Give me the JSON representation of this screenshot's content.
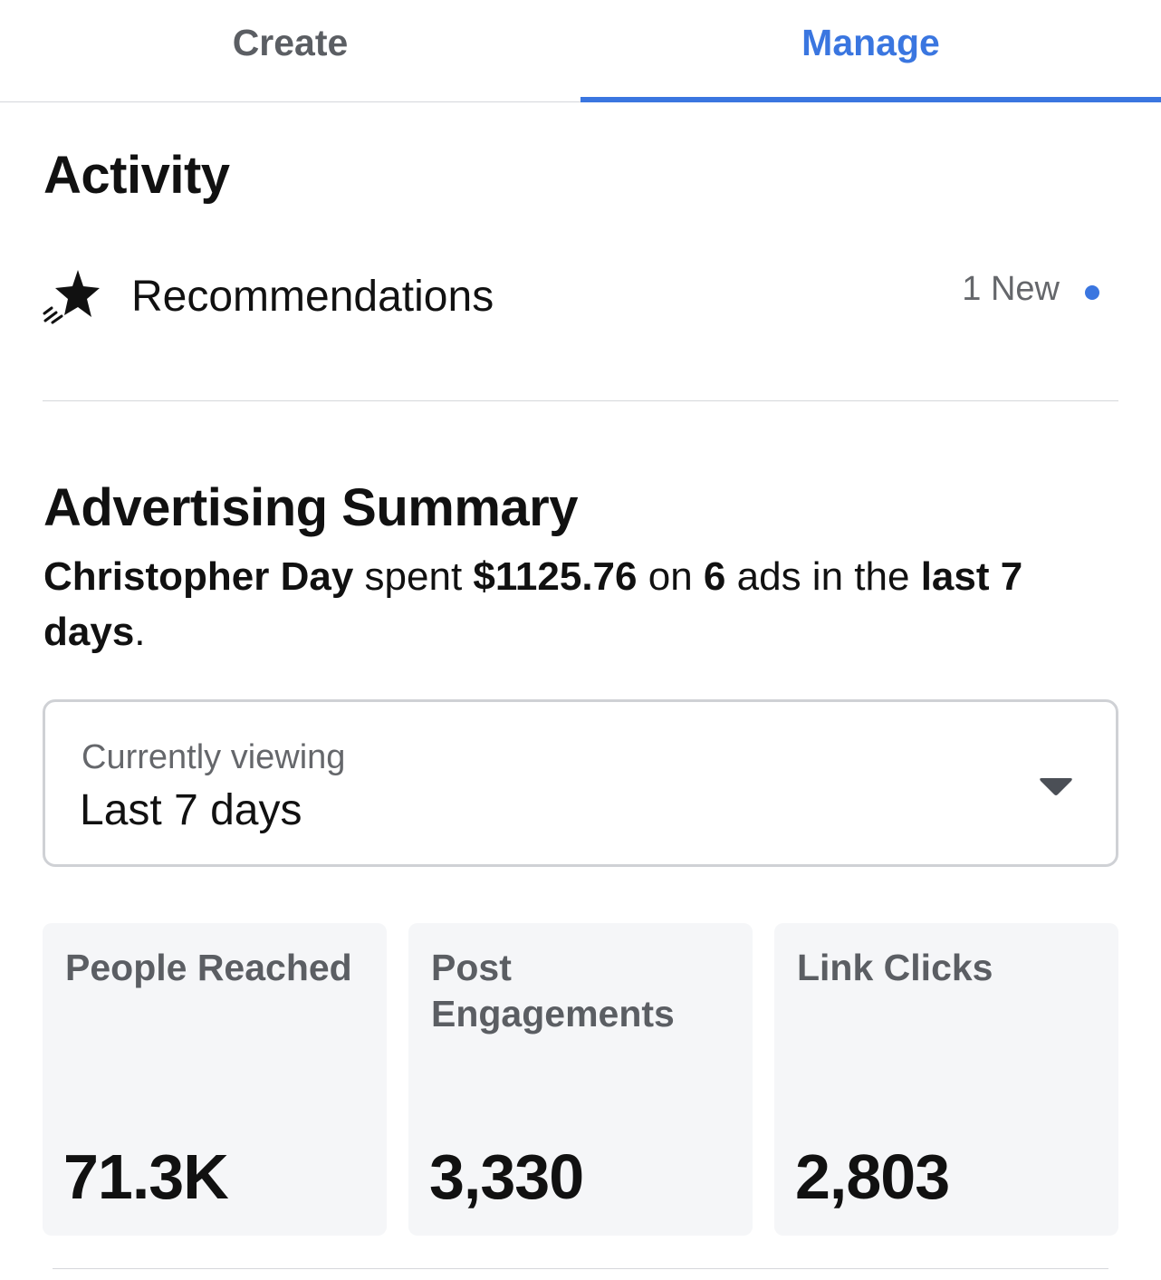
{
  "tabs": [
    {
      "label": "Create",
      "active": false
    },
    {
      "label": "Manage",
      "active": true
    }
  ],
  "activity": {
    "title": "Activity",
    "recommendations": {
      "label": "Recommendations",
      "badge": "1 New",
      "icon": "shooting-star-icon"
    }
  },
  "summary": {
    "title": "Advertising Summary",
    "name": "Christopher Day",
    "spent_word": "spent",
    "amount": "$1125.76",
    "on_word": "on",
    "count": "6",
    "ads_phrase": "ads in the",
    "period": "last 7 days",
    "period_end": "."
  },
  "selector": {
    "label": "Currently viewing",
    "value": "Last 7 days",
    "icon": "caret-down-icon"
  },
  "metrics": [
    {
      "label": "People Reached",
      "value": "71.3K"
    },
    {
      "label": "Post Engagements",
      "value": "3,330"
    },
    {
      "label": "Link Clicks",
      "value": "2,803"
    }
  ],
  "colors": {
    "accent": "#3a76e0",
    "card_bg": "#f5f6f8",
    "muted_text": "#65676b"
  }
}
